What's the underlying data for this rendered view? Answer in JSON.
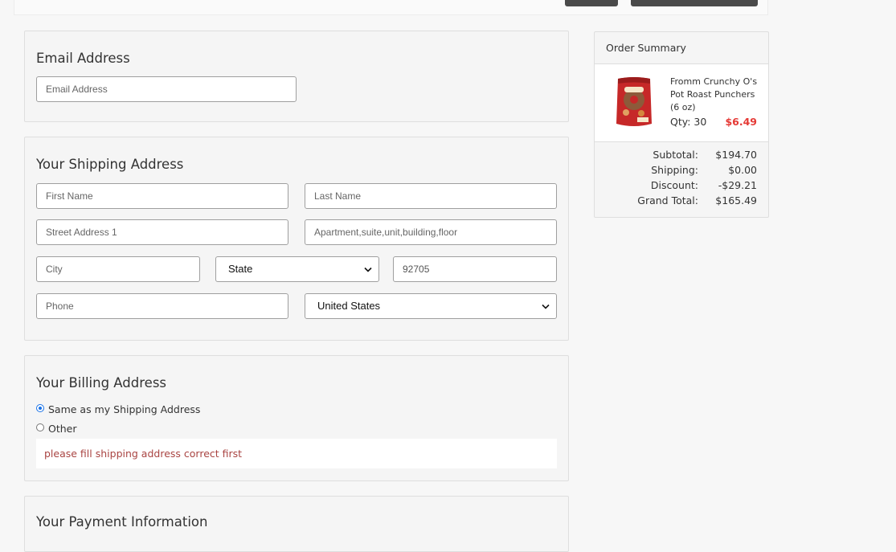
{
  "email_section": {
    "title": "Email Address",
    "email_placeholder": "Email Address"
  },
  "shipping": {
    "title": "Your Shipping Address",
    "first_name_placeholder": "First Name",
    "last_name_placeholder": "Last Name",
    "street1_placeholder": "Street Address 1",
    "street2_placeholder": "Apartment,suite,unit,building,floor",
    "city_placeholder": "City",
    "state_value": "State",
    "zip_value": "92705",
    "phone_placeholder": "Phone",
    "country_value": "United States"
  },
  "billing": {
    "title": "Your Billing Address",
    "same_label": "Same as my Shipping Address",
    "other_label": "Other",
    "selected": "same",
    "warning": "please fill shipping address correct first"
  },
  "payment": {
    "title": "Your Payment Information"
  },
  "summary": {
    "title": "Order Summary",
    "item": {
      "name": "Fromm Crunchy O's Pot Roast Punchers (6 oz)",
      "qty_label": "Qty: 30",
      "price": "$6.49",
      "image_text": "Crunchy"
    },
    "subtotal_label": "Subtotal:",
    "subtotal_value": "$194.70",
    "shipping_label": "Shipping:",
    "shipping_value": "$0.00",
    "discount_label": "Discount:",
    "discount_value": "-$29.21",
    "grand_label": "Grand Total:",
    "grand_value": "$165.49"
  },
  "colors": {
    "accent_price": "#e53935",
    "warning_text": "#a94442",
    "radio_selected": "#1a73e8"
  },
  "icons": {
    "select_arrow": "chevron-down-icon"
  }
}
